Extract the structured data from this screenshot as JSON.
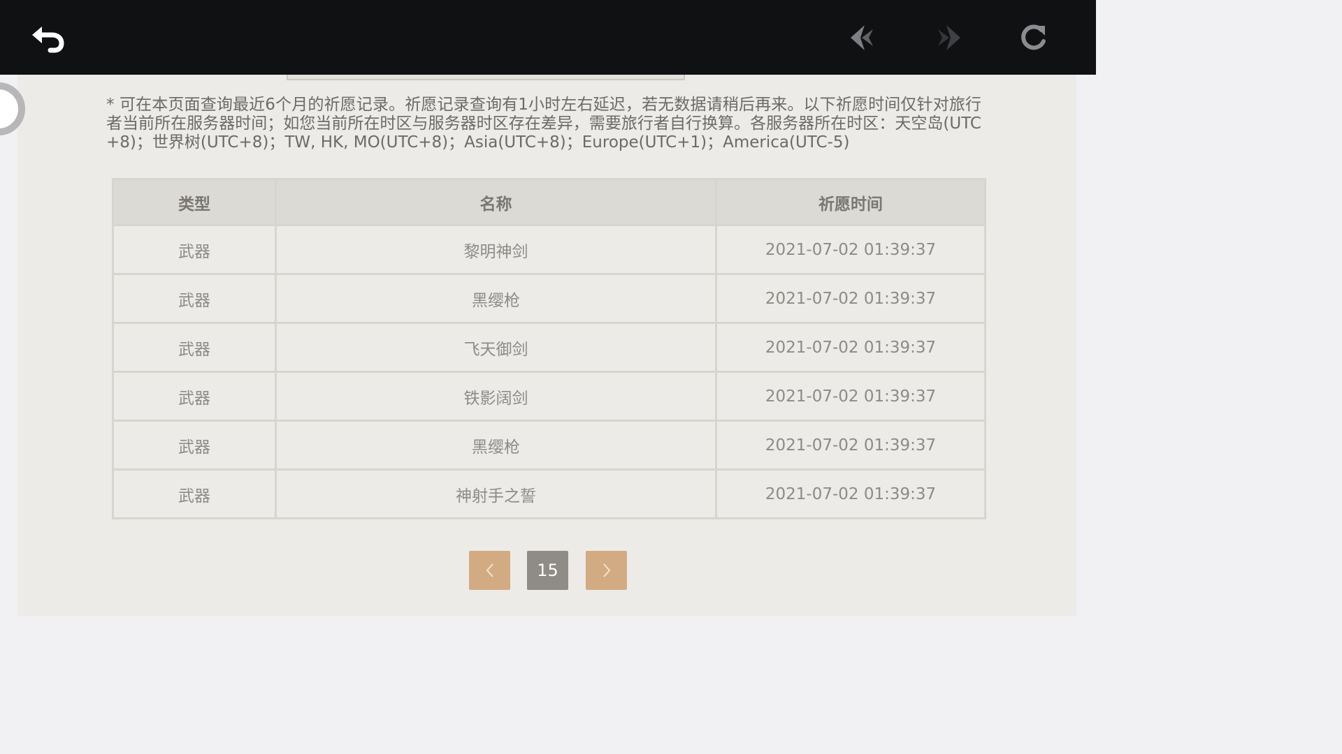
{
  "toolbar": {
    "back_icon": "back-arrow-icon",
    "prev_icon": "nav-back-diamond-icon",
    "next_icon": "nav-forward-diamond-icon",
    "refresh_icon": "refresh-icon"
  },
  "notice": "* 可在本页面查询最近6个月的祈愿记录。祈愿记录查询有1小时左右延迟，若无数据请稍后再来。以下祈愿时间仅针对旅行者当前所在服务器时间；如您当前所在时区与服务器时区存在差异，需要旅行者自行换算。各服务器所在时区：天空岛(UTC+8)；世界树(UTC+8)；TW, HK, MO(UTC+8)；Asia(UTC+8)；Europe(UTC+1)；America(UTC-5)",
  "table": {
    "headers": [
      "类型",
      "名称",
      "祈愿时间"
    ],
    "rows": [
      {
        "type": "武器",
        "name": "黎明神剑",
        "time": "2021-07-02 01:39:37"
      },
      {
        "type": "武器",
        "name": "黑缨枪",
        "time": "2021-07-02 01:39:37"
      },
      {
        "type": "武器",
        "name": "飞天御剑",
        "time": "2021-07-02 01:39:37"
      },
      {
        "type": "武器",
        "name": "铁影阔剑",
        "time": "2021-07-02 01:39:37"
      },
      {
        "type": "武器",
        "name": "黑缨枪",
        "time": "2021-07-02 01:39:37"
      },
      {
        "type": "武器",
        "name": "神射手之誓",
        "time": "2021-07-02 01:39:37"
      }
    ]
  },
  "pagination": {
    "prev_label": "‹",
    "current_page": "15",
    "next_label": "›"
  },
  "colors": {
    "topbar": "#0f1113",
    "panel": "#ecebe7",
    "pager_button": "#d3ab82",
    "pager_current": "#8f8b86"
  }
}
